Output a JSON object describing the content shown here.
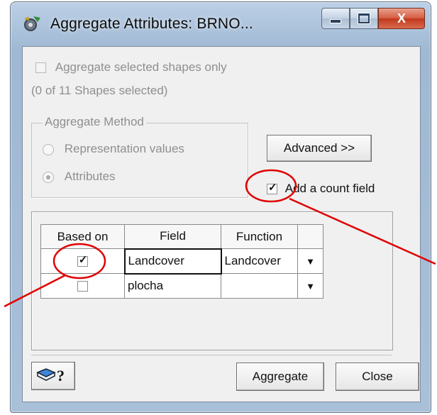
{
  "window": {
    "title": "Aggregate Attributes: BRNO...",
    "caption_buttons": {
      "minimize": "–",
      "maximize": "□",
      "close": "X"
    }
  },
  "selection": {
    "checkbox_label": "Aggregate selected shapes only",
    "count_text": "(0 of 11 Shapes selected)",
    "checked": false,
    "enabled": false
  },
  "aggregate_method": {
    "legend": "Aggregate Method",
    "options": [
      {
        "label": "Representation values",
        "selected": false
      },
      {
        "label": "Attributes",
        "selected": true
      }
    ]
  },
  "advanced_button": "Advanced >>",
  "count_field": {
    "label": "Add a count field",
    "checked": true
  },
  "table": {
    "headers": [
      "Based on",
      "Field",
      "Function",
      ""
    ],
    "rows": [
      {
        "based_on": true,
        "field": "Landcover",
        "function": "Landcover",
        "dropdown": "▼"
      },
      {
        "based_on": false,
        "field": "plocha",
        "function": "",
        "dropdown": "▼"
      }
    ]
  },
  "footer": {
    "help_glyph": "?",
    "aggregate_button": "Aggregate",
    "close_button": "Close"
  },
  "annotation_color": "#e00000"
}
